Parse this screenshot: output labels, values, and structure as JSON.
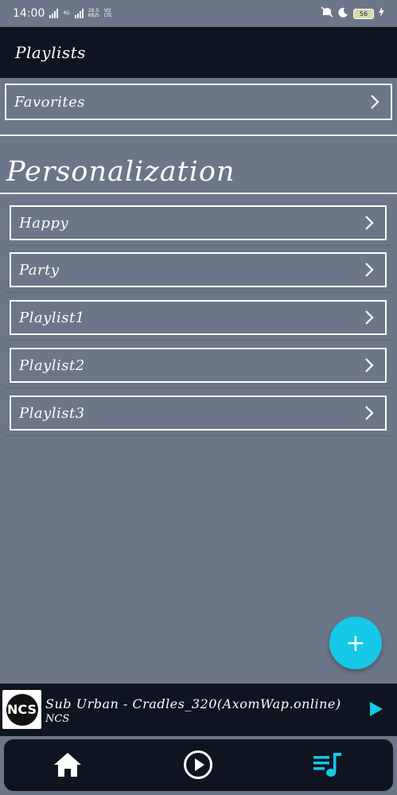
{
  "status_bar": {
    "time": "14:00",
    "net_speed_top": "29.0",
    "net_speed_bottom": "KB/S",
    "volte_top": "VO",
    "volte_bottom": "LTE",
    "network_4g": "4G",
    "battery": "56"
  },
  "app_bar": {
    "title": "Playlists"
  },
  "favorites": {
    "label": "Favorites"
  },
  "section": {
    "title": "Personalization"
  },
  "playlists": [
    {
      "label": "Happy"
    },
    {
      "label": "Party"
    },
    {
      "label": "Playlist1"
    },
    {
      "label": "Playlist2"
    },
    {
      "label": "Playlist3"
    }
  ],
  "fab": {
    "symbol": "+"
  },
  "now_playing": {
    "title": "Sub Urban - Cradles_320(AxomWap.online)",
    "artist": "NCS",
    "art_text": "NCS"
  },
  "nav": {
    "items": [
      {
        "icon": "home-icon"
      },
      {
        "icon": "play-circle-icon"
      },
      {
        "icon": "playlist-icon"
      }
    ],
    "active_color": "#16c8e8",
    "inactive_color": "#ffffff"
  },
  "colors": {
    "background": "#6c7689",
    "bar": "#0e1420",
    "accent": "#16c8e8"
  }
}
